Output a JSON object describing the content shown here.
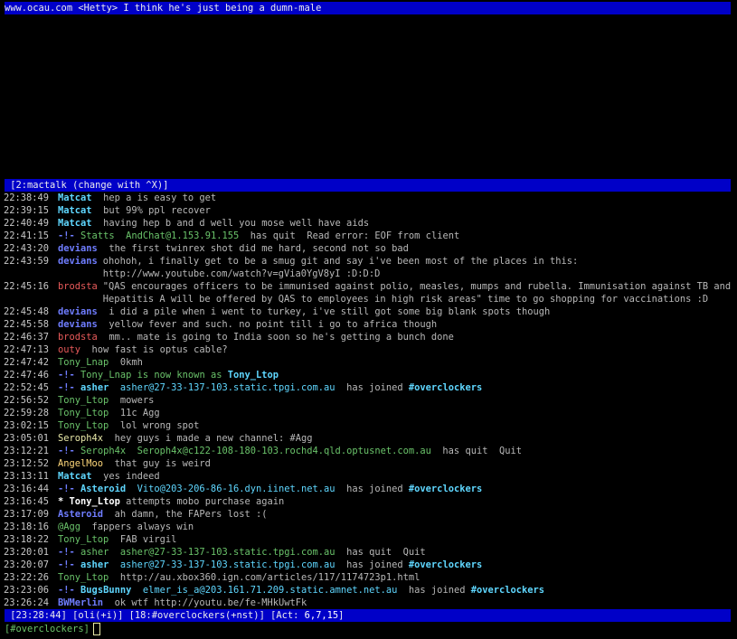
{
  "top_bar": "www.ocau.com <Hetty> I think he's just being a dumn-male",
  "window_bar": " [2:mactalk (change with ^X)]",
  "messages": [
    {
      "ts": "22:38:49",
      "kind": "msg",
      "nick": "Matcat",
      "nickClass": "n-matcat",
      "text": "hep a is easy to get"
    },
    {
      "ts": "22:39:15",
      "kind": "msg",
      "nick": "Matcat",
      "nickClass": "n-matcat",
      "text": "but 99% ppl recover"
    },
    {
      "ts": "22:40:49",
      "kind": "msg",
      "nick": "Matcat",
      "nickClass": "n-matcat",
      "text": "having hep b and d well you mose well have aids"
    },
    {
      "ts": "22:41:15",
      "kind": "quit",
      "arrow": "-!-",
      "nick": "Statts",
      "host": "AndChat@1.153.91.155",
      "verb": "has quit",
      "reason": "Read error: EOF from client"
    },
    {
      "ts": "22:43:20",
      "kind": "msg",
      "nick": "devians",
      "nickClass": "n-devians",
      "text": "the first twinrex shot did me hard, second not so bad"
    },
    {
      "ts": "22:43:59",
      "kind": "msg",
      "nick": "devians",
      "nickClass": "n-devians",
      "text": "ohohoh, i finally get to be a smug git and say i've been most of the places in this:\nhttp://www.youtube.com/watch?v=gVia0YgV8yI :D:D:D"
    },
    {
      "ts": "22:45:16",
      "kind": "msg",
      "nick": "brodsta",
      "nickClass": "n-brodsta",
      "text": "\"QAS encourages officers to be immunised against polio, measles, mumps and rubella. Immunisation against TB and\nHepatitis A will be offered by QAS to employees in high risk areas\" time to go shopping for vaccinations :D"
    },
    {
      "ts": "22:45:48",
      "kind": "msg",
      "nick": "devians",
      "nickClass": "n-devians",
      "text": "i did a pile when i went to turkey, i've still got some big blank spots though"
    },
    {
      "ts": "22:45:58",
      "kind": "msg",
      "nick": "devians",
      "nickClass": "n-devians",
      "text": "yellow fever and such. no point till i go to africa though"
    },
    {
      "ts": "22:46:37",
      "kind": "msg",
      "nick": "brodsta",
      "nickClass": "n-brodsta",
      "text": "mm.. mate is going to India soon so he's getting a bunch done"
    },
    {
      "ts": "22:47:13",
      "kind": "msg",
      "nick": "outy",
      "nickClass": "n-outy",
      "text": "how fast is optus cable?"
    },
    {
      "ts": "22:47:42",
      "kind": "msg",
      "nick": "Tony_Lnap",
      "nickClass": "n-green",
      "text": "0kmh"
    },
    {
      "ts": "22:47:46",
      "kind": "nickchange",
      "arrow": "-!-",
      "nick": "Tony_Lnap",
      "verb": "is now known as",
      "newnick": "Tony_Ltop"
    },
    {
      "ts": "22:52:45",
      "kind": "join",
      "arrow": "-!-",
      "nick": "asher",
      "host": "asher@27-33-137-103.static.tpgi.com.au",
      "verb": "has joined",
      "chan": "#overclockers"
    },
    {
      "ts": "22:56:52",
      "kind": "msg",
      "nick": "Tony_Ltop",
      "nickClass": "n-green",
      "text": "mowers"
    },
    {
      "ts": "22:59:28",
      "kind": "msg",
      "nick": "Tony_Ltop",
      "nickClass": "n-green",
      "text": "11c Agg"
    },
    {
      "ts": "23:02:15",
      "kind": "msg",
      "nick": "Tony_Ltop",
      "nickClass": "n-green",
      "text": "lol wrong spot"
    },
    {
      "ts": "23:05:01",
      "kind": "msg",
      "nick": "Seroph4x",
      "nickClass": "n-seroph",
      "text": "hey guys i made a new channel: #Agg"
    },
    {
      "ts": "23:12:21",
      "kind": "quit",
      "arrow": "-!-",
      "nick": "Seroph4x",
      "host": "Seroph4x@c122-108-180-103.rochd4.qld.optusnet.com.au",
      "verb": "has quit",
      "reason": "Quit"
    },
    {
      "ts": "23:12:52",
      "kind": "msg",
      "nick": "AngelMoo",
      "nickClass": "n-angel",
      "text": "that guy is weird"
    },
    {
      "ts": "23:13:11",
      "kind": "msg",
      "nick": "Matcat",
      "nickClass": "n-matcat",
      "text": "yes indeed"
    },
    {
      "ts": "23:16:44",
      "kind": "join",
      "arrow": "-!-",
      "nick": "Asteroid",
      "host": "Vito@203-206-86-16.dyn.iinet.net.au",
      "verb": "has joined",
      "chan": "#overclockers"
    },
    {
      "ts": "23:16:45",
      "kind": "action",
      "star": "*",
      "nick": "Tony_Ltop",
      "text": "attempts mobo purchase again"
    },
    {
      "ts": "23:17:09",
      "kind": "msg",
      "nick": "Asteroid",
      "nickClass": "n-devians",
      "text": "ah damn, the FAPers lost :("
    },
    {
      "ts": "23:18:16",
      "kind": "msg",
      "nick": "@Agg",
      "nickClass": "n-green",
      "text": "fappers always win"
    },
    {
      "ts": "23:18:22",
      "kind": "msg",
      "nick": "Tony_Ltop",
      "nickClass": "n-green",
      "text": "FAB virgil"
    },
    {
      "ts": "23:20:01",
      "kind": "quit",
      "arrow": "-!-",
      "nick": "asher",
      "host": "asher@27-33-137-103.static.tpgi.com.au",
      "verb": "has quit",
      "reason": "Quit"
    },
    {
      "ts": "23:20:07",
      "kind": "join",
      "arrow": "-!-",
      "nick": "asher",
      "host": "asher@27-33-137-103.static.tpgi.com.au",
      "verb": "has joined",
      "chan": "#overclockers"
    },
    {
      "ts": "23:22:26",
      "kind": "msg",
      "nick": "Tony_Ltop",
      "nickClass": "n-green",
      "text": "http://au.xbox360.ign.com/articles/117/1174723p1.html"
    },
    {
      "ts": "23:23:06",
      "kind": "join",
      "arrow": "-!-",
      "nick": "BugsBunny",
      "host": "elmer_is_a@203.161.71.209.static.amnet.net.au",
      "verb": "has joined",
      "chan": "#overclockers"
    },
    {
      "ts": "23:26:24",
      "kind": "msg",
      "nick": "BWMerlin",
      "nickClass": "n-bw",
      "text": "ok wtf http://youtu.be/fe-MHkUwtFk"
    }
  ],
  "status_bar": {
    "time": "23:28:44",
    "user": "oli(+i)",
    "window": "18:#overclockers(+nst)",
    "act_label": "Act: ",
    "act_values": "6,7,15"
  },
  "input": {
    "prompt": "[#overclockers]"
  },
  "colors": {
    "bar_bg": "#0000c8",
    "background": "#000000"
  }
}
